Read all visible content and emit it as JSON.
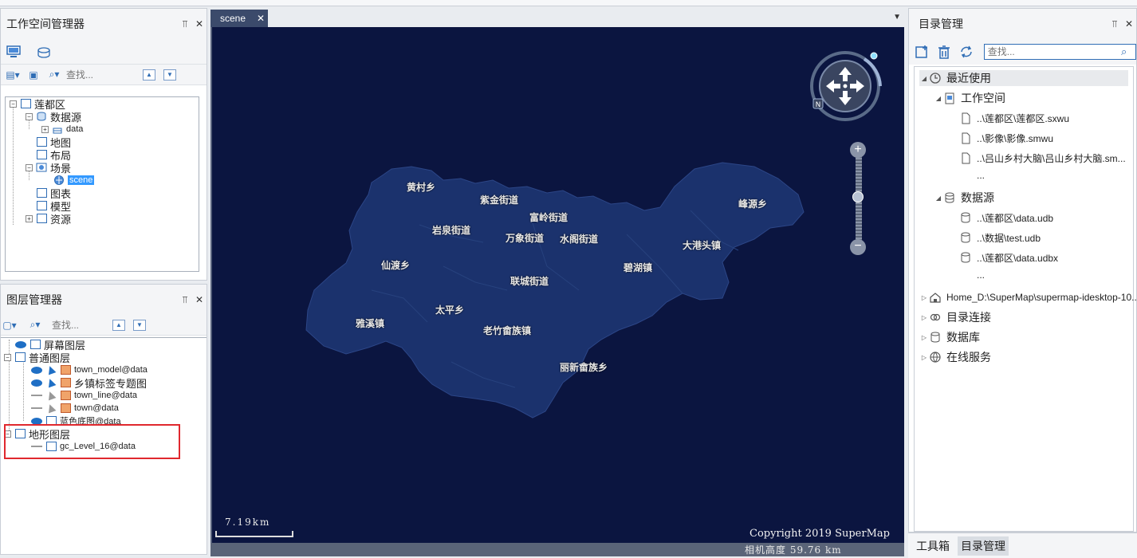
{
  "workspace_panel": {
    "title": "工作空间管理器",
    "search_placeholder": "查找...",
    "tree": {
      "root": "莲都区",
      "datasources": "数据源",
      "data": "data",
      "maps": "地图",
      "layouts": "布局",
      "scenes": "场景",
      "scene": "scene",
      "charts": "图表",
      "models": "模型",
      "resources": "资源"
    }
  },
  "layer_panel": {
    "title": "图层管理器",
    "search_placeholder": "查找...",
    "layers": {
      "screen": "屏幕图层",
      "normal": "普通图层",
      "town_model": "town_model@data",
      "town_label": "乡镇标签专题图",
      "town_line": "town_line@data",
      "town": "town@data",
      "basemap": "蓝色底图@data",
      "terrain": "地形图层",
      "gc_level": "gc_Level_16@data"
    }
  },
  "scene_view": {
    "tab": "scene",
    "scale_label": "7.19km",
    "copyright": "Copyright 2019 SuperMap",
    "camera_height": "相机高度 59.76 km",
    "towns": [
      "黄村乡",
      "紫金街道",
      "富岭街道",
      "岩泉街道",
      "万象街道",
      "水阁街道",
      "大港头镇",
      "峰源乡",
      "碧湖镇",
      "仙渡乡",
      "联城街道",
      "太平乡",
      "雅溪镇",
      "老竹畲族镇",
      "丽新畲族乡"
    ]
  },
  "catalog_panel": {
    "title": "目录管理",
    "search_placeholder": "查找...",
    "recent": "最近使用",
    "workspace": "工作空间",
    "ws_files": [
      "..\\莲都区\\莲都区.sxwu",
      "..\\影像\\影像.smwu",
      "..\\吕山乡村大脑\\吕山乡村大脑.sm..."
    ],
    "ellipsis": "...",
    "datasource": "数据源",
    "ds_files": [
      "..\\莲都区\\data.udb",
      "..\\数据\\test.udb",
      "..\\莲都区\\data.udbx"
    ],
    "home": "Home_D:\\SuperMap\\supermap-idesktop-10...",
    "catalog_conn": "目录连接",
    "database": "数据库",
    "online": "在线服务"
  },
  "bottom_tabs": {
    "toolbox": "工具箱",
    "catalog": "目录管理"
  }
}
